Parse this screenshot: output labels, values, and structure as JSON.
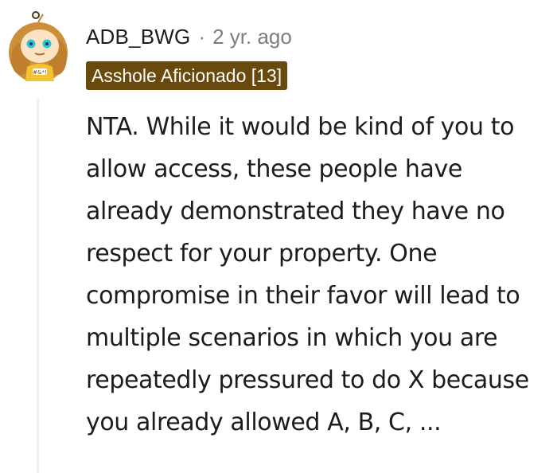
{
  "comment": {
    "author": "ADB_BWG",
    "separator": "·",
    "age": "2 yr. ago",
    "flair": "Asshole Aficionado [13]",
    "body": "NTA. While it would be kind of you to allow access, these people have already demonstrated they have no respect for your property. One compromise in their favor will lead to multiple scenarios in which you are repeatedly pressured to do X because you already allowed A, B, C, ...",
    "avatar_icon": "snoo-avatar-icon"
  },
  "colors": {
    "flair_background": "#6a4a0c",
    "flair_text": "#ffffff",
    "meta_text": "#7c7c7c",
    "body_text": "#1c1c1c",
    "thread_line": "#edeff1"
  }
}
